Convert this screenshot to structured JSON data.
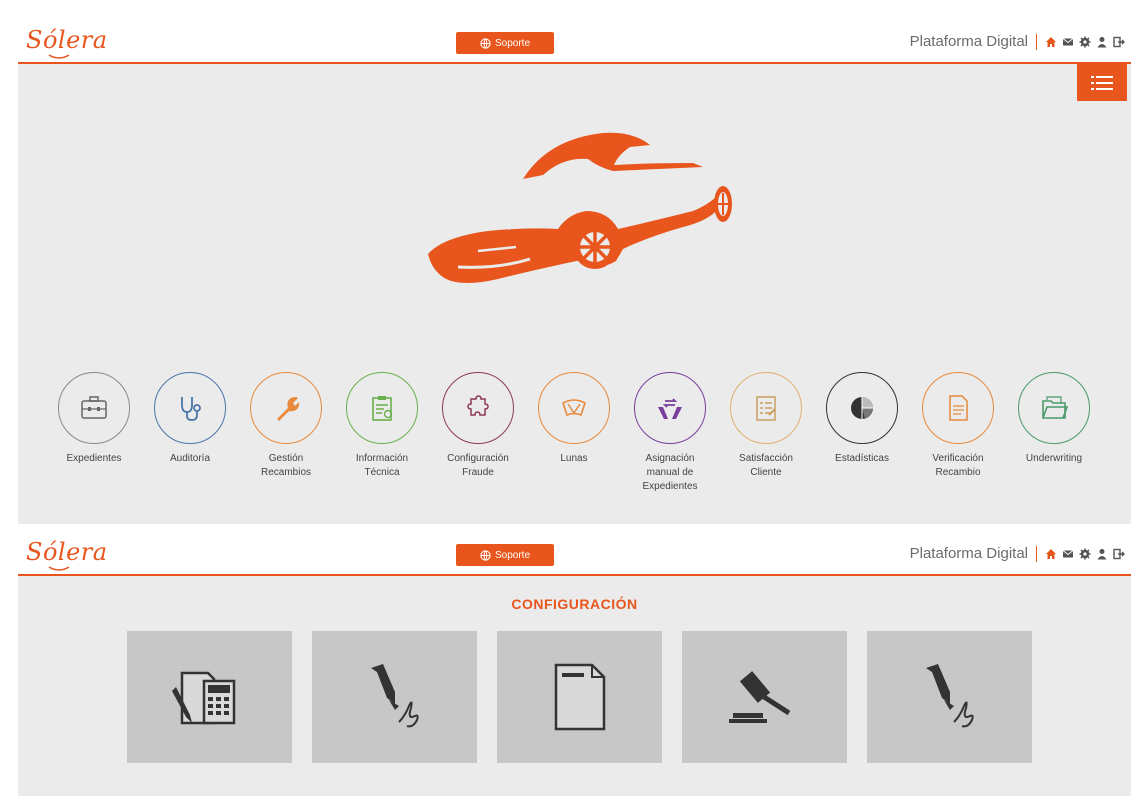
{
  "header": {
    "logo": "Sólera",
    "support_label": "Soporte",
    "platform_label": "Plataforma Digital",
    "icons": [
      "home-icon",
      "mail-icon",
      "gear-icon",
      "user-icon",
      "logout-icon"
    ]
  },
  "colors": {
    "brand": "#e8561e",
    "panel_bg": "#ebebeb",
    "tile_bg": "#c7c7c7"
  },
  "modules": [
    {
      "label": "Expedientes",
      "icon": "briefcase-icon",
      "color": "#8a8a8a"
    },
    {
      "label": "Auditoría",
      "icon": "stethoscope-icon",
      "color": "#4a76a8"
    },
    {
      "label": "Gestión\nRecambios",
      "icon": "wrench-icon",
      "color": "#e8893b"
    },
    {
      "label": "Información\nTécnica",
      "icon": "clipboard-car-icon",
      "color": "#6ab04c"
    },
    {
      "label": "Configuración\nFraude",
      "icon": "puzzle-icon",
      "color": "#8e3a59"
    },
    {
      "label": "Lunas",
      "icon": "windshield-icon",
      "color": "#e8893b"
    },
    {
      "label": "Asignación\nmanual de\nExpedientes",
      "icon": "hands-transfer-icon",
      "color": "#7a3e9d"
    },
    {
      "label": "Satisfacción\nCliente",
      "icon": "survey-icon",
      "color": "#e0b070"
    },
    {
      "label": "Estadísticas",
      "icon": "pie-chart-icon",
      "color": "#333333"
    },
    {
      "label": "Verificación\nRecambio",
      "icon": "document-icon",
      "color": "#e8893b"
    },
    {
      "label": "Underwriting",
      "icon": "folder-icon",
      "color": "#4a9a6a"
    }
  ],
  "config": {
    "title": "CONFIGURACIÓN",
    "tiles": [
      {
        "icon": "calculator-document-icon"
      },
      {
        "icon": "pen-signature-icon"
      },
      {
        "icon": "blank-document-icon"
      },
      {
        "icon": "gavel-icon"
      },
      {
        "icon": "pen-signature-icon"
      }
    ]
  }
}
